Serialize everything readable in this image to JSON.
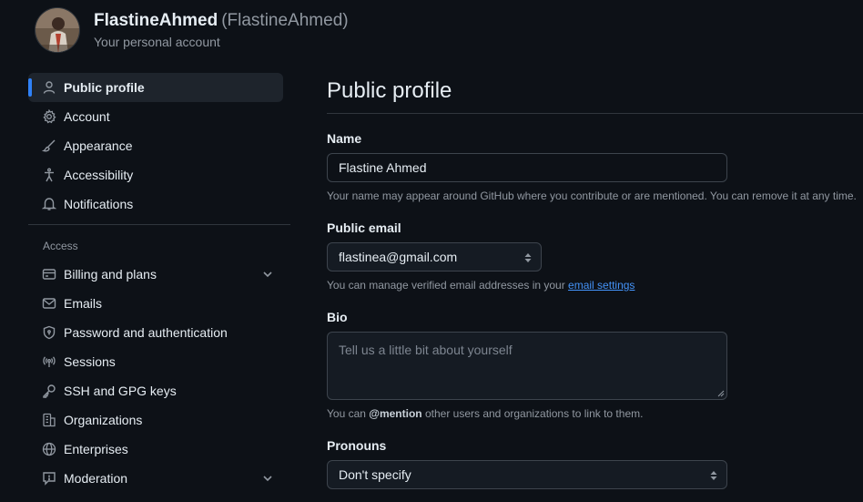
{
  "account": {
    "display_name": "FlastineAhmed",
    "login": "(FlastineAhmed)",
    "subtitle": "Your personal account"
  },
  "sidebar": {
    "items_top": [
      {
        "label": "Public profile",
        "icon": "person-icon",
        "active": true
      },
      {
        "label": "Account",
        "icon": "gear-icon"
      },
      {
        "label": "Appearance",
        "icon": "paintbrush-icon"
      },
      {
        "label": "Accessibility",
        "icon": "accessibility-icon"
      },
      {
        "label": "Notifications",
        "icon": "bell-icon"
      }
    ],
    "section_access": "Access",
    "items_access": [
      {
        "label": "Billing and plans",
        "icon": "credit-card-icon",
        "expandable": true
      },
      {
        "label": "Emails",
        "icon": "mail-icon"
      },
      {
        "label": "Password and authentication",
        "icon": "shield-lock-icon"
      },
      {
        "label": "Sessions",
        "icon": "broadcast-icon"
      },
      {
        "label": "SSH and GPG keys",
        "icon": "key-icon"
      },
      {
        "label": "Organizations",
        "icon": "organization-icon"
      },
      {
        "label": "Enterprises",
        "icon": "globe-icon"
      },
      {
        "label": "Moderation",
        "icon": "report-icon",
        "expandable": true
      }
    ]
  },
  "main": {
    "title": "Public profile",
    "name": {
      "label": "Name",
      "value": "Flastine Ahmed",
      "note": "Your name may appear around GitHub where you contribute or are mentioned. You can remove it at any time."
    },
    "email": {
      "label": "Public email",
      "value": "flastinea@gmail.com",
      "note_prefix": "You can manage verified email addresses in your ",
      "note_link": "email settings"
    },
    "bio": {
      "label": "Bio",
      "placeholder": "Tell us a little bit about yourself",
      "note_prefix": "You can ",
      "note_mention": "@mention",
      "note_suffix": " other users and organizations to link to them."
    },
    "pronouns": {
      "label": "Pronouns",
      "value": "Don't specify"
    }
  },
  "colors": {
    "background": "#0d1117",
    "accent": "#2f81f7",
    "link": "#4493f8",
    "muted": "#9198a1"
  }
}
